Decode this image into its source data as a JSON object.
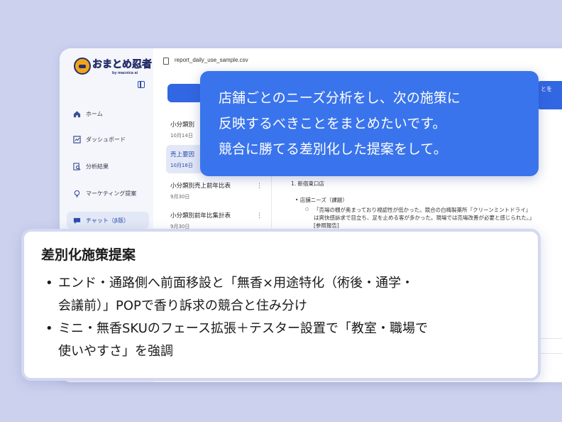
{
  "app": {
    "logo_title": "おまとめ忍者",
    "logo_sub": "by macnica ai",
    "file_name": "report_daily_use_sample.csv",
    "right_button_partial": "とを"
  },
  "sidebar": {
    "items": [
      {
        "label": "ホーム",
        "icon": "home-icon"
      },
      {
        "label": "ダッシュボード",
        "icon": "chart-icon"
      },
      {
        "label": "分析結果",
        "icon": "search-doc-icon"
      },
      {
        "label": "マーケティング提案",
        "icon": "bulb-icon"
      },
      {
        "label": "チャット（β版）",
        "icon": "chat-icon"
      }
    ]
  },
  "history": [
    {
      "title": "小分類別",
      "date": "10月14日"
    },
    {
      "title": "売上要因",
      "date": "10月16日"
    },
    {
      "title": "小分類別売上前年比表",
      "date": "9月30日"
    },
    {
      "title": "小分類別前年比集計表",
      "date": "9月30日"
    }
  ],
  "content": {
    "heading": "1. 新宿東口店",
    "bullet": "• 店舗ニーズ（課題）",
    "sub": "「売場の棚が奥まっており視認性が低かった。競合の白梅製薬所『クリーンミントドライ』は爽快感訴求で目立ち、足を止める客が多かった。現場では売場改善が必要と感じられた。」[参照報告]"
  },
  "prompt": {
    "lines": [
      "店舗ごとのニーズ分析をし、次の施策に",
      "反映するべきことをまとめたいです。",
      "競合に勝てる差別化した提案をして。"
    ]
  },
  "answer": {
    "title": "差別化施策提案",
    "bullets": [
      {
        "line1": "エンド・通路側へ前面移設と「無香×用途特化（術後・通学・",
        "line2": "会議前）」POPで香り訴求の競合と住み分け"
      },
      {
        "line1": "ミニ・無香SKUのフェース拡張＋テスター設置で「教室・職場で",
        "line2": "使いやすさ」を強調"
      }
    ]
  },
  "colors": {
    "background": "#ccd2ee",
    "accent": "#3a74ec",
    "button": "#3267e3",
    "sidebar_active": "#e2e8f6"
  }
}
